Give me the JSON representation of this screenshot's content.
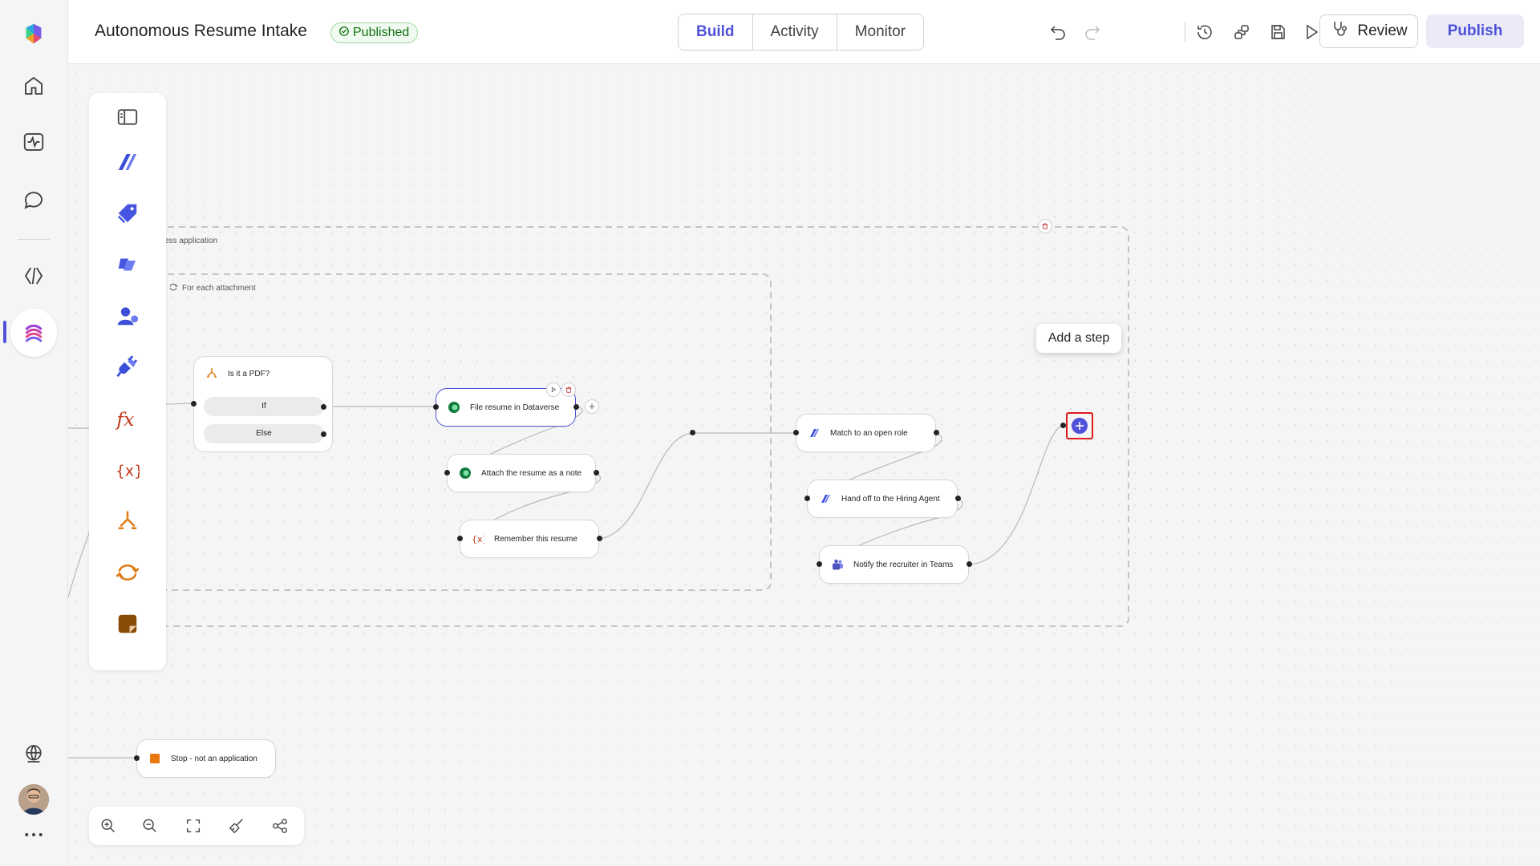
{
  "app": {
    "title": "Autonomous Resume Intake",
    "status_badge": "Published",
    "accent": "#4f52d8"
  },
  "header": {
    "tabs": [
      {
        "label": "Build",
        "active": true
      },
      {
        "label": "Activity",
        "active": false
      },
      {
        "label": "Monitor",
        "active": false
      }
    ],
    "icons": [
      "undo-icon",
      "redo-icon",
      "history-icon",
      "connections-icon",
      "save-icon",
      "run-icon",
      "chevron-down-icon",
      "more-icon"
    ],
    "review_label": "Review",
    "publish_label": "Publish"
  },
  "rail": {
    "items": [
      "copilot-logo-icon",
      "home-icon",
      "activity-icon",
      "chat-icon",
      "code-icon",
      "agent-flows-icon",
      "globe-icon",
      "avatar",
      "more-icon"
    ],
    "active": "agent-flows-icon"
  },
  "canvas": {
    "scopes": [
      {
        "label": "ess application"
      },
      {
        "label": "For each attachment"
      }
    ],
    "condition": {
      "title": "Is it a PDF?",
      "branches": [
        "If",
        "Else"
      ]
    },
    "steps": [
      {
        "label": "File resume in Dataverse",
        "icon": "dataverse-icon",
        "selected": true
      },
      {
        "label": "Attach the resume as a note",
        "icon": "dataverse-icon"
      },
      {
        "label": "Remember this resume",
        "icon": "variable-icon"
      },
      {
        "label": "Match to an open role",
        "icon": "copilot-studio-icon"
      },
      {
        "label": "Hand off to the Hiring Agent",
        "icon": "copilot-studio-icon"
      },
      {
        "label": "Notify the recruiter in Teams",
        "icon": "teams-icon"
      },
      {
        "label": "Stop - not an application",
        "icon": "stop-icon"
      }
    ],
    "tooltip": "Add a step"
  },
  "palette": {
    "items": [
      "toggle-panel-icon",
      "copilot-studio-icon",
      "tag-icon",
      "copilot-icon",
      "agent-person-icon",
      "connector-icon",
      "fx-icon",
      "variable-icon",
      "condition-icon",
      "loop-icon",
      "note-icon"
    ]
  },
  "zoombar": {
    "items": [
      "zoom-in-icon",
      "zoom-out-icon",
      "fit-view-icon",
      "clean-up-icon",
      "layout-icon"
    ]
  }
}
